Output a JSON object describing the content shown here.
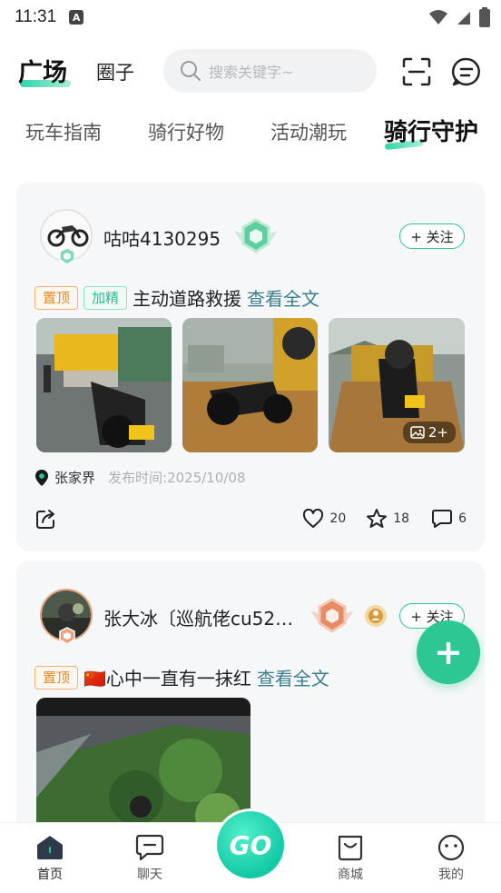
{
  "status": {
    "time": "11:31",
    "notif_letter": "A"
  },
  "header": {
    "tab_active": "广场",
    "tab_other": "圈子",
    "search_placeholder": "搜索关键字~"
  },
  "categories": [
    "玩车指南",
    "骑行好物",
    "活动潮玩",
    "骑行守护"
  ],
  "posts": [
    {
      "username": "咕咕4130295",
      "follow_label": "+ 关注",
      "tags": [
        "置顶",
        "加精"
      ],
      "title": "主动道路救援",
      "read_more": "查看全文",
      "photo_count": "2+",
      "location": "张家界",
      "published": "发布时间:2025/10/08",
      "likes": "20",
      "favorites": "18",
      "comments": "6"
    },
    {
      "username": "张大冰〔巡航佬cu52…",
      "follow_label": "+ 关注",
      "tags": [
        "置顶"
      ],
      "title": "🇨🇳心中一直有一抹红",
      "read_more": "查看全文"
    }
  ],
  "fab_label": "+",
  "bottom_nav": {
    "home": "首页",
    "chat": "聊天",
    "go": "GO",
    "shop": "商城",
    "mine": "我的"
  },
  "colors": {
    "accent": "#2dc793",
    "top_tag": "#e38a2c",
    "fine_tag": "#2dbd8f",
    "link": "#3a7f8f"
  }
}
